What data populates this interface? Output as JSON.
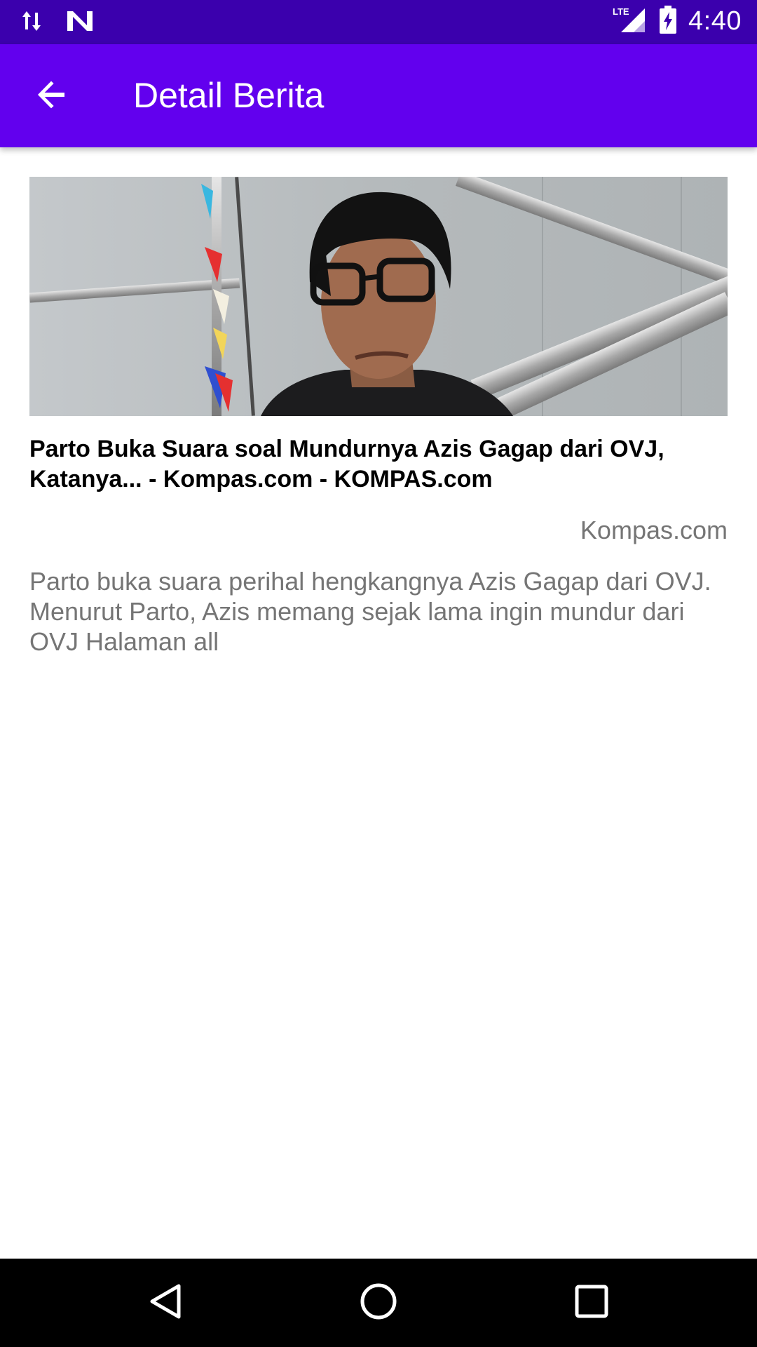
{
  "status_bar": {
    "time": "4:40",
    "network_label": "LTE",
    "icons": [
      "data-transfer-icon",
      "n-notification-icon",
      "lte-signal-icon",
      "battery-charging-icon"
    ]
  },
  "app_bar": {
    "title": "Detail Berita",
    "back_icon": "arrow-left-icon",
    "color": "#6200ee"
  },
  "article": {
    "headline": "Parto Buka Suara soal Mundurnya Azis Gagap dari OVJ, Katanya... - Kompas.com - KOMPAS.com",
    "source": "Kompas.com",
    "description": "Parto buka suara perihal hengkangnya Azis Gagap dari OVJ. Menurut Parto, Azis memang sejak lama ingin mundur dari OVJ Halaman all"
  },
  "nav_bar": {
    "buttons": [
      "back-triangle-icon",
      "home-circle-icon",
      "recents-square-icon"
    ]
  },
  "colors": {
    "status_bar": "#3b00ad",
    "app_bar": "#6200ee",
    "secondary_text": "#757575"
  }
}
